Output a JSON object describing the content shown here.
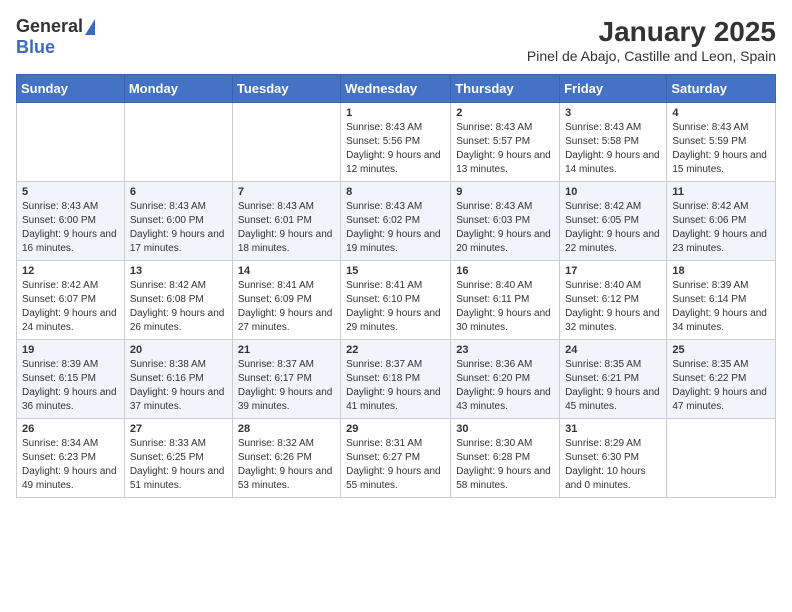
{
  "header": {
    "logo_general": "General",
    "logo_blue": "Blue",
    "title": "January 2025",
    "subtitle": "Pinel de Abajo, Castille and Leon, Spain"
  },
  "days_of_week": [
    "Sunday",
    "Monday",
    "Tuesday",
    "Wednesday",
    "Thursday",
    "Friday",
    "Saturday"
  ],
  "weeks": [
    [
      {
        "day": "",
        "sunrise": "",
        "sunset": "",
        "daylight": ""
      },
      {
        "day": "",
        "sunrise": "",
        "sunset": "",
        "daylight": ""
      },
      {
        "day": "",
        "sunrise": "",
        "sunset": "",
        "daylight": ""
      },
      {
        "day": "1",
        "sunrise": "Sunrise: 8:43 AM",
        "sunset": "Sunset: 5:56 PM",
        "daylight": "Daylight: 9 hours and 12 minutes."
      },
      {
        "day": "2",
        "sunrise": "Sunrise: 8:43 AM",
        "sunset": "Sunset: 5:57 PM",
        "daylight": "Daylight: 9 hours and 13 minutes."
      },
      {
        "day": "3",
        "sunrise": "Sunrise: 8:43 AM",
        "sunset": "Sunset: 5:58 PM",
        "daylight": "Daylight: 9 hours and 14 minutes."
      },
      {
        "day": "4",
        "sunrise": "Sunrise: 8:43 AM",
        "sunset": "Sunset: 5:59 PM",
        "daylight": "Daylight: 9 hours and 15 minutes."
      }
    ],
    [
      {
        "day": "5",
        "sunrise": "Sunrise: 8:43 AM",
        "sunset": "Sunset: 6:00 PM",
        "daylight": "Daylight: 9 hours and 16 minutes."
      },
      {
        "day": "6",
        "sunrise": "Sunrise: 8:43 AM",
        "sunset": "Sunset: 6:00 PM",
        "daylight": "Daylight: 9 hours and 17 minutes."
      },
      {
        "day": "7",
        "sunrise": "Sunrise: 8:43 AM",
        "sunset": "Sunset: 6:01 PM",
        "daylight": "Daylight: 9 hours and 18 minutes."
      },
      {
        "day": "8",
        "sunrise": "Sunrise: 8:43 AM",
        "sunset": "Sunset: 6:02 PM",
        "daylight": "Daylight: 9 hours and 19 minutes."
      },
      {
        "day": "9",
        "sunrise": "Sunrise: 8:43 AM",
        "sunset": "Sunset: 6:03 PM",
        "daylight": "Daylight: 9 hours and 20 minutes."
      },
      {
        "day": "10",
        "sunrise": "Sunrise: 8:42 AM",
        "sunset": "Sunset: 6:05 PM",
        "daylight": "Daylight: 9 hours and 22 minutes."
      },
      {
        "day": "11",
        "sunrise": "Sunrise: 8:42 AM",
        "sunset": "Sunset: 6:06 PM",
        "daylight": "Daylight: 9 hours and 23 minutes."
      }
    ],
    [
      {
        "day": "12",
        "sunrise": "Sunrise: 8:42 AM",
        "sunset": "Sunset: 6:07 PM",
        "daylight": "Daylight: 9 hours and 24 minutes."
      },
      {
        "day": "13",
        "sunrise": "Sunrise: 8:42 AM",
        "sunset": "Sunset: 6:08 PM",
        "daylight": "Daylight: 9 hours and 26 minutes."
      },
      {
        "day": "14",
        "sunrise": "Sunrise: 8:41 AM",
        "sunset": "Sunset: 6:09 PM",
        "daylight": "Daylight: 9 hours and 27 minutes."
      },
      {
        "day": "15",
        "sunrise": "Sunrise: 8:41 AM",
        "sunset": "Sunset: 6:10 PM",
        "daylight": "Daylight: 9 hours and 29 minutes."
      },
      {
        "day": "16",
        "sunrise": "Sunrise: 8:40 AM",
        "sunset": "Sunset: 6:11 PM",
        "daylight": "Daylight: 9 hours and 30 minutes."
      },
      {
        "day": "17",
        "sunrise": "Sunrise: 8:40 AM",
        "sunset": "Sunset: 6:12 PM",
        "daylight": "Daylight: 9 hours and 32 minutes."
      },
      {
        "day": "18",
        "sunrise": "Sunrise: 8:39 AM",
        "sunset": "Sunset: 6:14 PM",
        "daylight": "Daylight: 9 hours and 34 minutes."
      }
    ],
    [
      {
        "day": "19",
        "sunrise": "Sunrise: 8:39 AM",
        "sunset": "Sunset: 6:15 PM",
        "daylight": "Daylight: 9 hours and 36 minutes."
      },
      {
        "day": "20",
        "sunrise": "Sunrise: 8:38 AM",
        "sunset": "Sunset: 6:16 PM",
        "daylight": "Daylight: 9 hours and 37 minutes."
      },
      {
        "day": "21",
        "sunrise": "Sunrise: 8:37 AM",
        "sunset": "Sunset: 6:17 PM",
        "daylight": "Daylight: 9 hours and 39 minutes."
      },
      {
        "day": "22",
        "sunrise": "Sunrise: 8:37 AM",
        "sunset": "Sunset: 6:18 PM",
        "daylight": "Daylight: 9 hours and 41 minutes."
      },
      {
        "day": "23",
        "sunrise": "Sunrise: 8:36 AM",
        "sunset": "Sunset: 6:20 PM",
        "daylight": "Daylight: 9 hours and 43 minutes."
      },
      {
        "day": "24",
        "sunrise": "Sunrise: 8:35 AM",
        "sunset": "Sunset: 6:21 PM",
        "daylight": "Daylight: 9 hours and 45 minutes."
      },
      {
        "day": "25",
        "sunrise": "Sunrise: 8:35 AM",
        "sunset": "Sunset: 6:22 PM",
        "daylight": "Daylight: 9 hours and 47 minutes."
      }
    ],
    [
      {
        "day": "26",
        "sunrise": "Sunrise: 8:34 AM",
        "sunset": "Sunset: 6:23 PM",
        "daylight": "Daylight: 9 hours and 49 minutes."
      },
      {
        "day": "27",
        "sunrise": "Sunrise: 8:33 AM",
        "sunset": "Sunset: 6:25 PM",
        "daylight": "Daylight: 9 hours and 51 minutes."
      },
      {
        "day": "28",
        "sunrise": "Sunrise: 8:32 AM",
        "sunset": "Sunset: 6:26 PM",
        "daylight": "Daylight: 9 hours and 53 minutes."
      },
      {
        "day": "29",
        "sunrise": "Sunrise: 8:31 AM",
        "sunset": "Sunset: 6:27 PM",
        "daylight": "Daylight: 9 hours and 55 minutes."
      },
      {
        "day": "30",
        "sunrise": "Sunrise: 8:30 AM",
        "sunset": "Sunset: 6:28 PM",
        "daylight": "Daylight: 9 hours and 58 minutes."
      },
      {
        "day": "31",
        "sunrise": "Sunrise: 8:29 AM",
        "sunset": "Sunset: 6:30 PM",
        "daylight": "Daylight: 10 hours and 0 minutes."
      },
      {
        "day": "",
        "sunrise": "",
        "sunset": "",
        "daylight": ""
      }
    ]
  ]
}
